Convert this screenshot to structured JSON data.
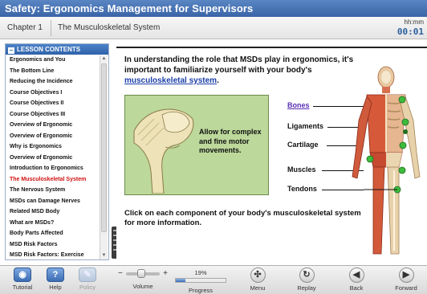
{
  "app": {
    "title": "Safety: Ergonomics Management for Supervisors"
  },
  "header": {
    "chapter": "Chapter 1",
    "topic": "The Musculoskeletal System",
    "time_label": "hh:mm",
    "time_value": "00:01"
  },
  "sidebar": {
    "heading": "LESSON CONTENTS",
    "items": [
      {
        "label": "Ergonomics and You"
      },
      {
        "label": "The Bottom Line"
      },
      {
        "label": "Reducing the Incidence"
      },
      {
        "label": "Course Objectives I"
      },
      {
        "label": "Course Objectives II"
      },
      {
        "label": "Course Objectives III"
      },
      {
        "label": "Overview of Ergonomic"
      },
      {
        "label": "Overview of Ergonomic"
      },
      {
        "label": "Why is Ergonomics"
      },
      {
        "label": "Overview of Ergonomic"
      },
      {
        "label": "Introduction to Ergonomics"
      },
      {
        "label": "The Musculoskeletal System",
        "active": true
      },
      {
        "label": "The Nervous System"
      },
      {
        "label": "MSDs can Damage Nerves"
      },
      {
        "label": "Related MSD Body"
      },
      {
        "label": "What are MSDs?"
      },
      {
        "label": "Body Parts Affected"
      },
      {
        "label": "MSD Risk Factors"
      },
      {
        "label": "MSD Risk Factors: Exercise"
      }
    ]
  },
  "content": {
    "intro_text": "In understanding the role that MSDs play in ergonomics, it's important to familiarize yourself with your body's",
    "intro_link": "musculoskeletal system",
    "intro_end": ".",
    "shoulder_text": "Allow for complex and fine motor movements.",
    "parts": {
      "bones": "Bones",
      "ligaments": "Ligaments",
      "cartilage": "Cartilage",
      "muscles": "Muscles",
      "tendons": "Tendons"
    },
    "cta": "Click on each component of your body's musculoskeletal system for more information."
  },
  "toolbar": {
    "tutorial": "Tutorial",
    "help": "Help",
    "policy": "Policy",
    "volume": "Volume",
    "volume_level": 0.45,
    "progress_label": "Progress",
    "progress_text": "19%",
    "progress_value": 0.19,
    "menu": "Menu",
    "replay": "Replay",
    "back": "Back",
    "forward": "Forward"
  },
  "colors": {
    "title_bar": "#3a64a6",
    "active_item": "#d01010",
    "link": "#1a3fa8",
    "highlight_box": "#bcd89a",
    "joint_marker": "#3dbb3d"
  }
}
